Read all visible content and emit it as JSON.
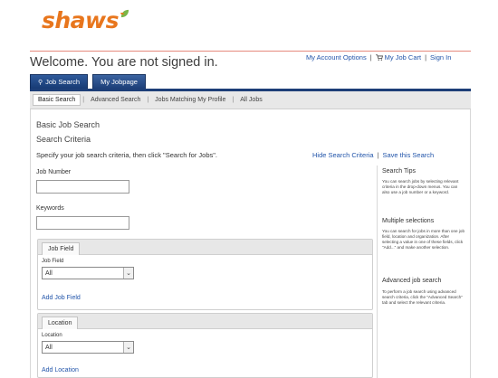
{
  "brand": {
    "logo_text": "shaws",
    "accent": "#e8761d",
    "leaf_color": "#7ab648"
  },
  "header": {
    "welcome": "Welcome. You are not signed in.",
    "links": {
      "my_account": "My Account Options",
      "job_cart": "My Job Cart",
      "sign_in": "Sign In"
    }
  },
  "tabs": [
    {
      "label": "Job Search",
      "icon": "search-icon",
      "active": true
    },
    {
      "label": "My Jobpage",
      "active": false
    }
  ],
  "subnav": [
    {
      "label": "Basic Search",
      "active": true
    },
    {
      "label": "Advanced Search"
    },
    {
      "label": "Jobs Matching My Profile"
    },
    {
      "label": "All Jobs"
    }
  ],
  "main": {
    "heading": "Basic Job Search",
    "subheading": "Search Criteria",
    "instructions": "Specify your job search criteria, then click \"Search for Jobs\".",
    "hide_criteria": "Hide Search Criteria",
    "save_search": "Save this Search",
    "job_number_label": "Job Number",
    "job_number_value": "",
    "keywords_label": "Keywords",
    "keywords_value": ""
  },
  "panels": {
    "job_field": {
      "tab": "Job Field",
      "field_label": "Job Field",
      "selected": "All",
      "add_link": "Add Job Field"
    },
    "location": {
      "tab": "Location",
      "field_label": "Location",
      "selected": "All",
      "add_link": "Add Location"
    }
  },
  "sidebar": {
    "tips_heading": "Search Tips",
    "tips_text": "You can search jobs by selecting relevant criteria in the drop-down menus. You can also use a job number or a keyword.",
    "multi_heading": "Multiple selections",
    "multi_text": "You can search for jobs in more than one job field, location and organization. After selecting a value in one of these fields, click \"Add...\" and make another selection.",
    "adv_heading": "Advanced job search",
    "adv_text": "To perform a job search using advanced search criteria, click the \"Advanced Search\" tab and select the relevant criteria."
  },
  "colors": {
    "nav_blue": "#1d3f78",
    "link_blue": "#2255aa",
    "rule_red": "#e58a7d"
  }
}
